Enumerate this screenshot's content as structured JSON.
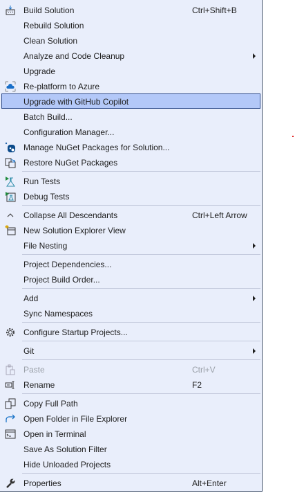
{
  "menu": {
    "items": [
      {
        "type": "item",
        "label": "Build Solution",
        "shortcut": "Ctrl+Shift+B",
        "icon": "build-icon"
      },
      {
        "type": "item",
        "label": "Rebuild Solution"
      },
      {
        "type": "item",
        "label": "Clean Solution"
      },
      {
        "type": "item",
        "label": "Analyze and Code Cleanup",
        "submenu": true
      },
      {
        "type": "item",
        "label": "Upgrade"
      },
      {
        "type": "item",
        "label": "Re-platform to Azure",
        "icon": "azure-cloud-icon"
      },
      {
        "type": "item",
        "label": "Upgrade with GitHub Copilot",
        "highlighted": true
      },
      {
        "type": "item",
        "label": "Batch Build..."
      },
      {
        "type": "item",
        "label": "Configuration Manager..."
      },
      {
        "type": "item",
        "label": "Manage NuGet Packages for Solution...",
        "icon": "nuget-icon"
      },
      {
        "type": "item",
        "label": "Restore NuGet Packages",
        "icon": "restore-packages-icon"
      },
      {
        "type": "separator"
      },
      {
        "type": "item",
        "label": "Run Tests",
        "icon": "run-tests-icon"
      },
      {
        "type": "item",
        "label": "Debug Tests",
        "icon": "debug-tests-icon"
      },
      {
        "type": "separator"
      },
      {
        "type": "item",
        "label": "Collapse All Descendants",
        "shortcut": "Ctrl+Left Arrow",
        "icon": "collapse-icon"
      },
      {
        "type": "item",
        "label": "New Solution Explorer View",
        "icon": "new-view-icon"
      },
      {
        "type": "item",
        "label": "File Nesting",
        "submenu": true
      },
      {
        "type": "separator"
      },
      {
        "type": "item",
        "label": "Project Dependencies..."
      },
      {
        "type": "item",
        "label": "Project Build Order..."
      },
      {
        "type": "separator"
      },
      {
        "type": "item",
        "label": "Add",
        "submenu": true
      },
      {
        "type": "item",
        "label": "Sync Namespaces"
      },
      {
        "type": "separator"
      },
      {
        "type": "item",
        "label": "Configure Startup Projects...",
        "icon": "gear-icon"
      },
      {
        "type": "separator"
      },
      {
        "type": "item",
        "label": "Git",
        "submenu": true
      },
      {
        "type": "separator"
      },
      {
        "type": "item",
        "label": "Paste",
        "shortcut": "Ctrl+V",
        "icon": "paste-icon",
        "disabled": true
      },
      {
        "type": "item",
        "label": "Rename",
        "shortcut": "F2",
        "icon": "rename-icon"
      },
      {
        "type": "separator"
      },
      {
        "type": "item",
        "label": "Copy Full Path",
        "icon": "copy-icon"
      },
      {
        "type": "item",
        "label": "Open Folder in File Explorer",
        "icon": "open-folder-arrow-icon"
      },
      {
        "type": "item",
        "label": "Open in Terminal",
        "icon": "terminal-icon"
      },
      {
        "type": "item",
        "label": "Save As Solution Filter"
      },
      {
        "type": "item",
        "label": "Hide Unloaded Projects"
      },
      {
        "type": "separator"
      },
      {
        "type": "item",
        "label": "Properties",
        "shortcut": "Alt+Enter",
        "icon": "wrench-icon"
      }
    ]
  }
}
